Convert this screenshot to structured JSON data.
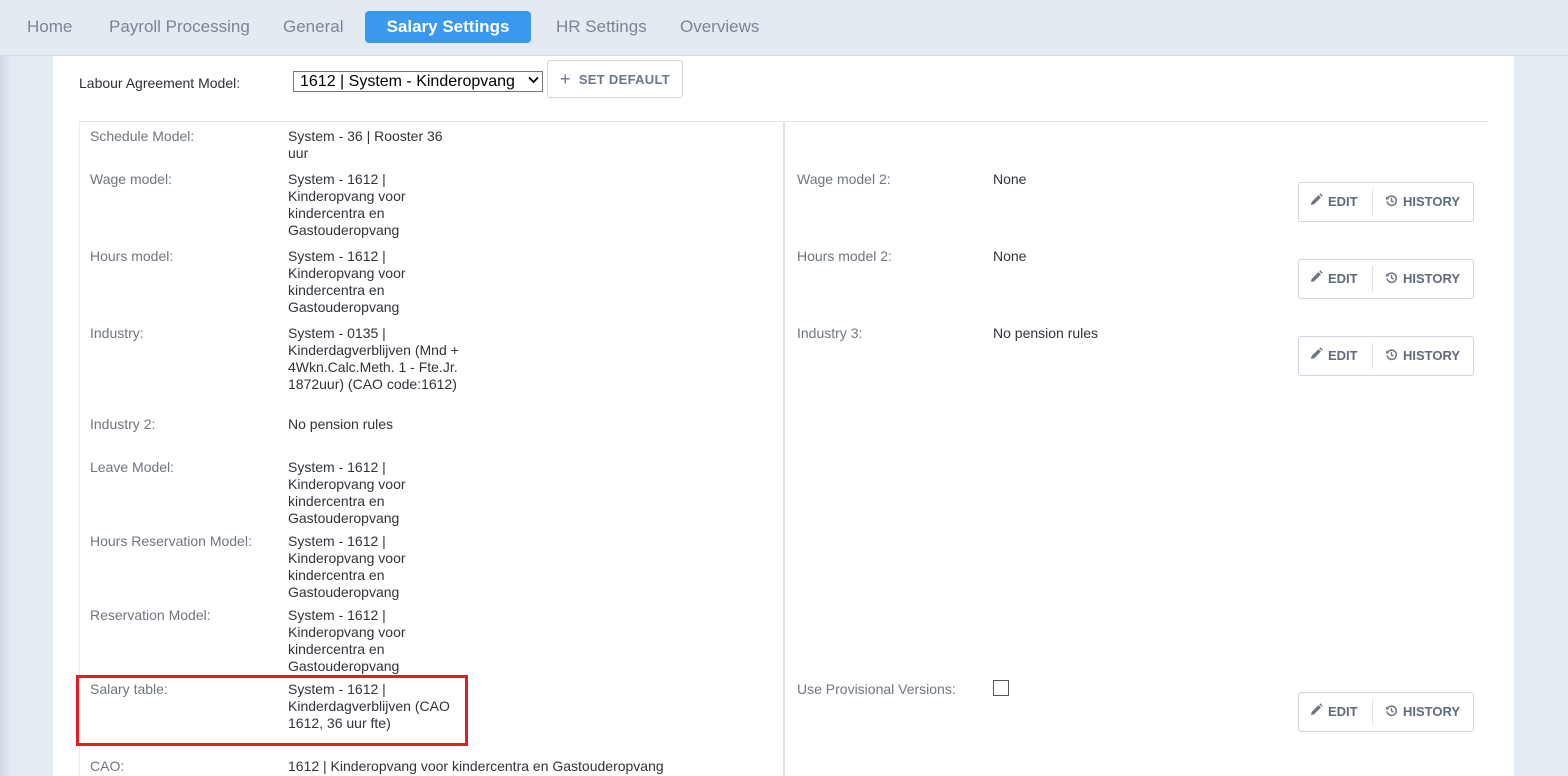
{
  "nav": {
    "tabs": [
      {
        "label": "Home"
      },
      {
        "label": "Payroll Processing"
      },
      {
        "label": "General"
      },
      {
        "label": "Salary Settings"
      },
      {
        "label": "HR Settings"
      },
      {
        "label": "Overviews"
      }
    ],
    "active_tab": "Salary Settings",
    "active_color": "#3a99ee"
  },
  "agreement": {
    "label": "Labour Agreement Model:",
    "selected": "1612 | System - Kinderopvang",
    "set_default_label": "SET DEFAULT"
  },
  "left_fields": [
    {
      "label": "Schedule Model:",
      "value": "System - 36 | Rooster 36 uur"
    },
    {
      "label": "Wage model:",
      "value": "System - 1612 | Kinderopvang voor kindercentra en Gastouderopvang"
    },
    {
      "label": "Hours model:",
      "value": "System - 1612 | Kinderopvang voor kindercentra en Gastouderopvang"
    },
    {
      "label": "Industry:",
      "value": "System - 0135 | Kinderdagverblijven (Mnd + 4Wkn.Calc.Meth. 1 - Fte.Jr. 1872uur) (CAO code:1612)"
    },
    {
      "label": "Industry 2:",
      "value": "No pension rules"
    },
    {
      "label": "Leave Model:",
      "value": "System - 1612 | Kinderopvang voor kindercentra en Gastouderopvang"
    },
    {
      "label": "Hours Reservation Model:",
      "value": "System - 1612 | Kinderopvang voor kindercentra en Gastouderopvang"
    },
    {
      "label": "Reservation Model:",
      "value": "System - 1612 | Kinderopvang voor kindercentra en Gastouderopvang"
    },
    {
      "label": "Salary table:",
      "value": "System - 1612 | Kinderdagverblijven (CAO 1612, 36 uur fte)"
    },
    {
      "label": "CAO:",
      "value": "1612 | Kinderopvang voor kindercentra en Gastouderopvang"
    }
  ],
  "right_fields": [
    {
      "label": "Wage model 2:",
      "value": "None"
    },
    {
      "label": "Hours model 2:",
      "value": "None"
    },
    {
      "label": "Industry 3:",
      "value": "No pension rules"
    },
    {
      "label": "Use Provisional Versions:",
      "value": ""
    }
  ],
  "buttons": {
    "edit": "EDIT",
    "history": "HISTORY"
  },
  "use_provisional_checked": false,
  "highlight_color": "#e01f26"
}
